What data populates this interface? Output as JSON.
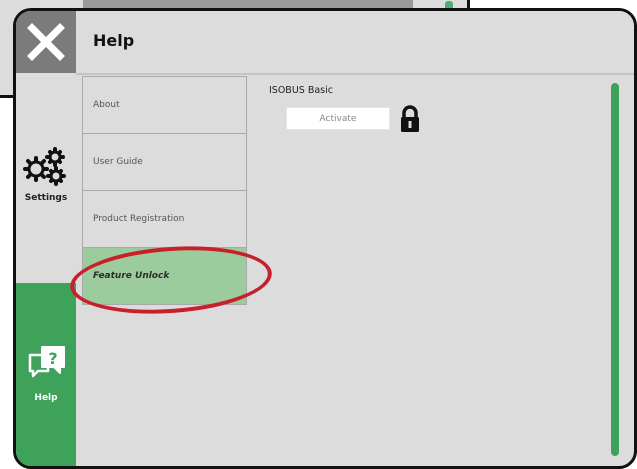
{
  "header": {
    "title": "Help"
  },
  "sidebar": {
    "items": [
      {
        "label": "Settings",
        "icon": "gears-icon"
      },
      {
        "label": "Help",
        "icon": "help-chat-icon"
      }
    ]
  },
  "menu": {
    "items": [
      {
        "label": "About"
      },
      {
        "label": "User Guide"
      },
      {
        "label": "Product Registration"
      },
      {
        "label": "Feature Unlock"
      }
    ]
  },
  "content": {
    "label": "ISOBUS Basic",
    "activate_label": "Activate",
    "lock_icon": "lock-icon"
  },
  "colors": {
    "accent_green": "#3fa25a",
    "selected_bg": "#9ccb9e",
    "highlight_red": "#c8202a"
  }
}
